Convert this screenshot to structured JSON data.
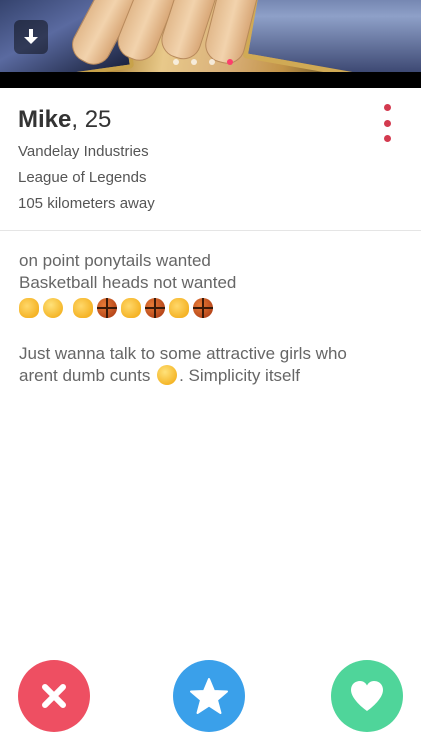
{
  "photo": {
    "pager_count": 4,
    "active_index": 3,
    "download_icon": "download-arrow-icon"
  },
  "profile": {
    "name": "Mike",
    "age_text": ", 25",
    "job": "Vandelay Industries",
    "school": "League of Legends",
    "distance": "105 kilometers away"
  },
  "bio": {
    "line1": "on point ponytails wanted",
    "line2": "Basketball heads not wanted",
    "emojis": [
      "ok-hand-icon",
      "laughing-face-icon",
      "waving-hand-icon",
      "basketball-icon",
      "waving-hand-icon",
      "basketball-icon",
      "waving-hand-icon",
      "basketball-icon"
    ],
    "para2_line1": "Just wanna talk to some attractive girls who",
    "para2_line2_before": "arent dumb cunts",
    "para2_line2_after": ". Simplicity itself"
  },
  "actions": {
    "nope_icon": "close-x-icon",
    "superlike_icon": "star-icon",
    "like_icon": "heart-icon"
  },
  "colors": {
    "accent_red": "#d33a4f",
    "nope": "#ee4f62",
    "superlike": "#3aa0ea",
    "like": "#4fd59a",
    "pager_active": "#fd3e6c"
  }
}
